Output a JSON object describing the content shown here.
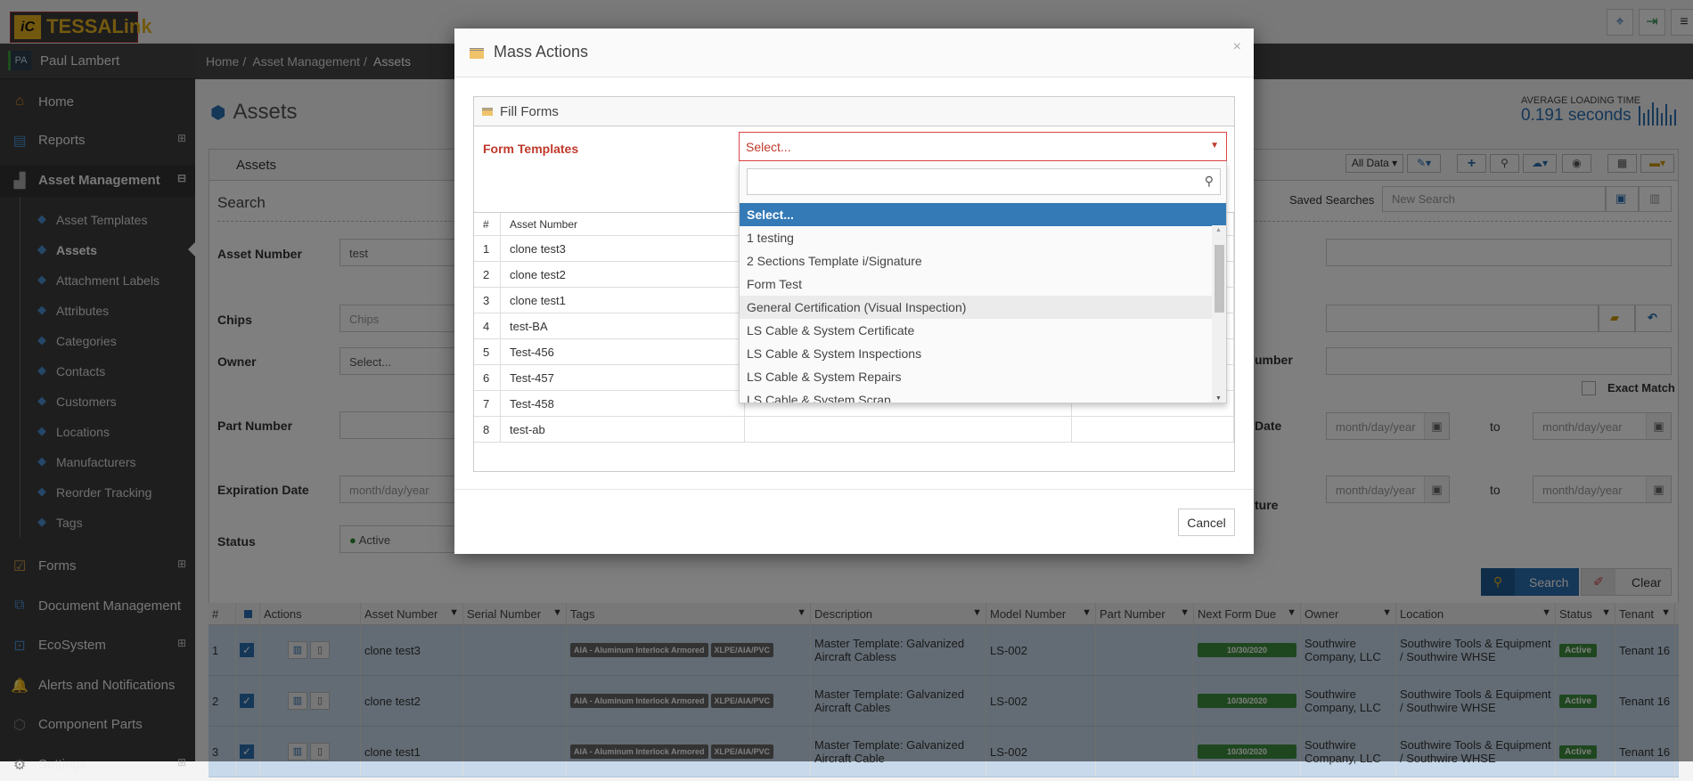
{
  "app": {
    "logo": "TESSALink",
    "logo_mark": "iC",
    "top_icons": [
      "network-monitor-icon",
      "logout-icon",
      "hamburger-menu-icon"
    ]
  },
  "user": {
    "initials": "PA",
    "name": "Paul Lambert"
  },
  "breadcrumb": [
    "Home",
    "Asset Management",
    "Assets"
  ],
  "sidebar": {
    "items": [
      {
        "label": "Home",
        "icon": "home-icon"
      },
      {
        "label": "Reports",
        "icon": "reports-icon",
        "expander": "⊞"
      },
      {
        "label": "Asset Management",
        "icon": "factory-icon",
        "expander": "⊟"
      }
    ],
    "sub_items": [
      {
        "label": "Asset Templates"
      },
      {
        "label": "Assets",
        "active": true
      },
      {
        "label": "Attachment Labels"
      },
      {
        "label": "Attributes"
      },
      {
        "label": "Categories"
      },
      {
        "label": "Contacts"
      },
      {
        "label": "Customers"
      },
      {
        "label": "Locations"
      },
      {
        "label": "Manufacturers"
      },
      {
        "label": "Reorder Tracking"
      },
      {
        "label": "Tags"
      }
    ],
    "items2": [
      {
        "label": "Forms",
        "expander": "⊞"
      },
      {
        "label": "Document Management"
      },
      {
        "label": "EcoSystem",
        "expander": "⊞"
      },
      {
        "label": "Alerts and Notifications"
      },
      {
        "label": "Component Parts"
      },
      {
        "label": "Settings",
        "expander": "⊞"
      }
    ]
  },
  "page": {
    "title": "Assets",
    "loading_label": "AVERAGE LOADING TIME",
    "loading_value": "0.191 seconds"
  },
  "panel": {
    "title": "Assets",
    "all_data": "All Data ▾",
    "search_heading": "Search",
    "saved_searches_label": "Saved Searches",
    "saved_search_placeholder": "New Search"
  },
  "form": {
    "asset_number": {
      "label": "Asset Number",
      "value": "test"
    },
    "chips": {
      "label": "Chips",
      "placeholder": "Chips"
    },
    "owner": {
      "label": "Owner",
      "value": "Select..."
    },
    "part_number": {
      "label": "Part Number"
    },
    "expiration_date": {
      "label": "Expiration Date",
      "placeholder": "month/day/year"
    },
    "status": {
      "label": "Status",
      "value": "Active"
    },
    "right_labels": [
      "umber",
      "Date",
      "ture"
    ],
    "exact_match": "Exact Match",
    "date_placeholder": "month/day/year",
    "to": "to",
    "search_btn": "Search",
    "clear_btn": "Clear"
  },
  "grid": {
    "columns": [
      "#",
      "",
      "Actions",
      "Asset Number",
      "Serial Number",
      "Tags",
      "Description",
      "Model Number",
      "Part Number",
      "Next Form Due",
      "Owner",
      "Location",
      "Status",
      "Tenant"
    ],
    "rows": [
      {
        "n": "1",
        "asset": "clone test3",
        "serial": "",
        "tags": [
          "AIA - Aluminum Interlock Armored",
          "XLPE/AIA/PVC"
        ],
        "desc": "Master Template: Galvanized Aircraft Cabless",
        "model": "LS-002",
        "part": "",
        "due": "10/30/2020",
        "owner": "Southwire Company, LLC",
        "location": "Southwire Tools & Equipment / Southwire WHSE",
        "status": "Active",
        "tenant": "Tenant 16"
      },
      {
        "n": "2",
        "asset": "clone test2",
        "serial": "",
        "tags": [
          "AIA - Aluminum Interlock Armored",
          "XLPE/AIA/PVC"
        ],
        "desc": "Master Template: Galvanized Aircraft Cables",
        "model": "LS-002",
        "part": "",
        "due": "10/30/2020",
        "owner": "Southwire Company, LLC",
        "location": "Southwire Tools & Equipment / Southwire WHSE",
        "status": "Active",
        "tenant": "Tenant 16"
      },
      {
        "n": "3",
        "asset": "clone test1",
        "serial": "",
        "tags": [
          "AIA - Aluminum Interlock Armored",
          "XLPE/AIA/PVC"
        ],
        "desc": "Master Template: Galvanized Aircraft Cable",
        "model": "LS-002",
        "part": "",
        "due": "10/30/2020",
        "owner": "Southwire Company, LLC",
        "location": "Southwire Tools & Equipment / Southwire WHSE",
        "status": "Active",
        "tenant": "Tenant 16"
      }
    ]
  },
  "modal": {
    "title": "Mass Actions",
    "close": "×",
    "section": "Fill Forms",
    "form_templates_label": "Form Templates",
    "select_value": "Select...",
    "table_headers": [
      "#",
      "Asset Number",
      "",
      ""
    ],
    "table_rows": [
      [
        "1",
        "clone test3"
      ],
      [
        "2",
        "clone test2"
      ],
      [
        "3",
        "clone test1"
      ],
      [
        "4",
        "test-BA"
      ],
      [
        "5",
        "Test-456"
      ],
      [
        "6",
        "Test-457"
      ],
      [
        "7",
        "Test-458"
      ],
      [
        "8",
        "test-ab"
      ]
    ],
    "options": [
      "Select...",
      "1 testing",
      "2 Sections Template i/Signature",
      "Form Test",
      "General Certification (Visual Inspection)",
      "LS Cable & System Certificate",
      "LS Cable & System Inspections",
      "LS Cable & System Repairs",
      "LS Cable & System Scrap"
    ],
    "hovered_option": "General Certification (Visual Inspection)",
    "cancel": "Cancel"
  },
  "colors": {
    "accent": "#337ab7",
    "required": "#c0392b",
    "active": "#3e8e3e"
  }
}
